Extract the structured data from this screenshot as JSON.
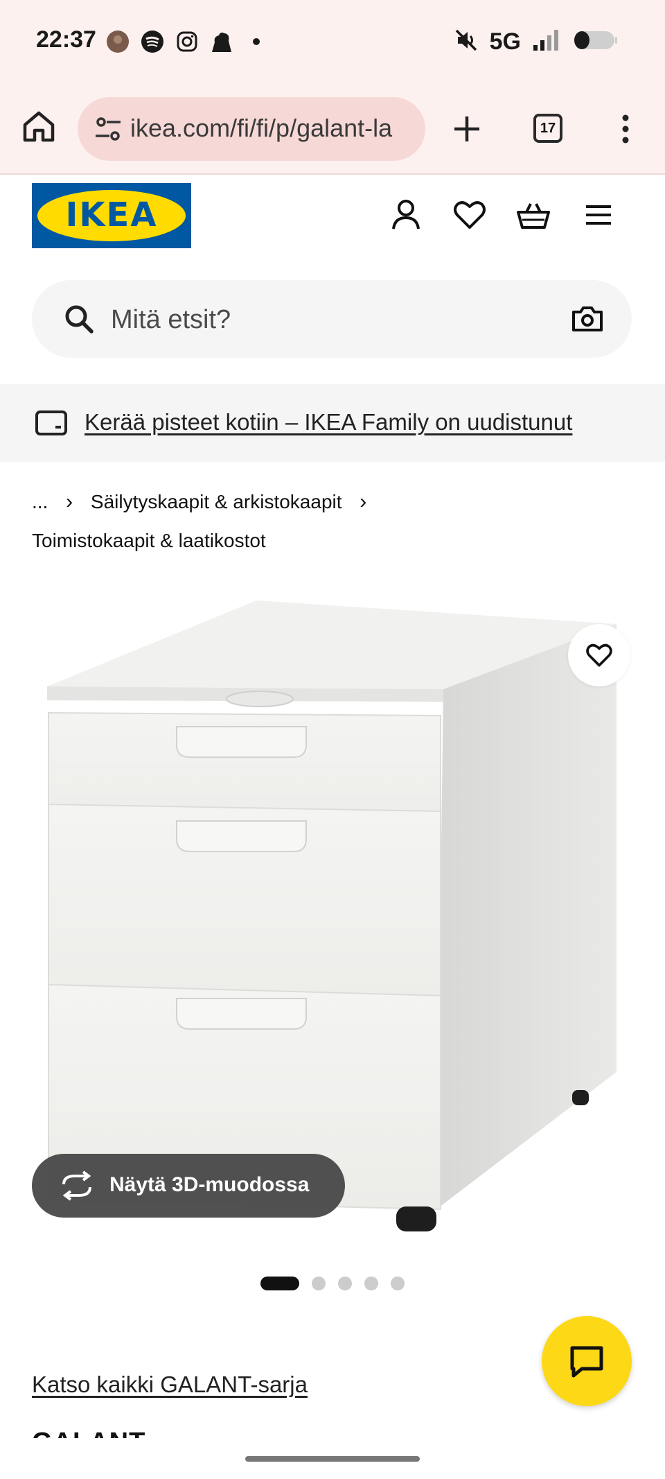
{
  "status_bar": {
    "time": "22:37",
    "left_icons": [
      "avatar-icon",
      "spotify-icon",
      "instagram-icon",
      "notification-icon",
      "dot-icon"
    ],
    "network": "5G",
    "right_icons": [
      "mute-icon",
      "signal-icon",
      "battery-icon"
    ]
  },
  "browser": {
    "url": "ikea.com/fi/fi/p/galant-la",
    "tab_count": "17"
  },
  "header": {
    "logo_text": "IKEA",
    "icons": [
      "account-icon",
      "heart-icon",
      "basket-icon",
      "menu-icon"
    ]
  },
  "search": {
    "placeholder": "Mitä etsit?"
  },
  "promo": {
    "text": "Kerää pisteet kotiin – IKEA Family on uudistunut"
  },
  "breadcrumb": {
    "ellipsis": "...",
    "item_1": "Säilytyskaapit & arkistokaapit",
    "item_2": "Toimistokaapit & laatikostot"
  },
  "gallery": {
    "view_3d_label": "Näytä 3D-muodossa",
    "image_count": 5,
    "active_index": 0
  },
  "product": {
    "series_link": "Katso kaikki GALANT-sarja",
    "name": "GALANT"
  },
  "colors": {
    "chrome_bg": "#fdf1ef",
    "url_pill": "#f6d9d6",
    "ikea_blue": "#0058a3",
    "ikea_yellow": "#ffdb00",
    "chat_yellow": "#fdd817"
  }
}
